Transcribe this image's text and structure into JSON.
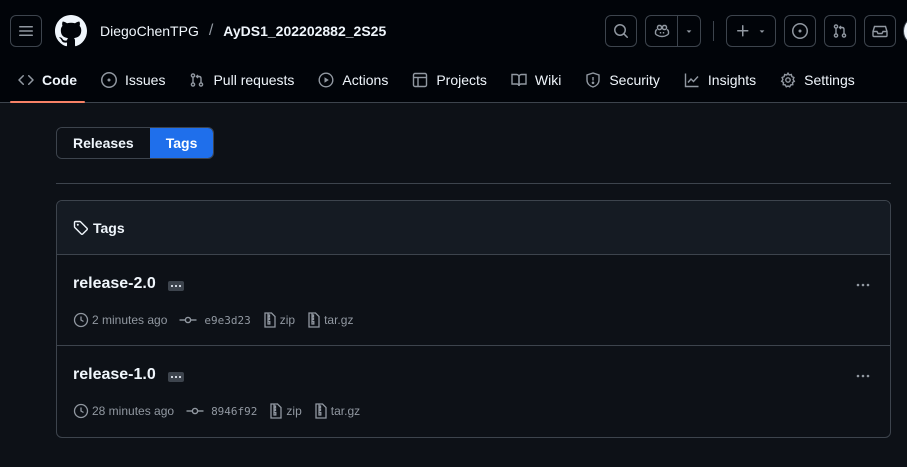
{
  "header": {
    "owner": "DiegoChenTPG",
    "separator": "/",
    "repo": "AyDS1_202202882_2S25"
  },
  "nav": {
    "tabs": [
      {
        "label": "Code",
        "icon": "code-icon",
        "selected": true
      },
      {
        "label": "Issues",
        "icon": "issue-opened-icon"
      },
      {
        "label": "Pull requests",
        "icon": "git-pull-request-icon"
      },
      {
        "label": "Actions",
        "icon": "play-icon"
      },
      {
        "label": "Projects",
        "icon": "table-icon"
      },
      {
        "label": "Wiki",
        "icon": "book-icon"
      },
      {
        "label": "Security",
        "icon": "shield-icon"
      },
      {
        "label": "Insights",
        "icon": "graph-icon"
      },
      {
        "label": "Settings",
        "icon": "gear-icon"
      }
    ]
  },
  "segmented": {
    "releases_label": "Releases",
    "tags_label": "Tags",
    "active": "Tags"
  },
  "tags_box": {
    "title": "Tags",
    "rows": [
      {
        "name": "release-2.0",
        "time": "2 minutes ago",
        "commit": "e9e3d23",
        "zip": "zip",
        "targz": "tar.gz"
      },
      {
        "name": "release-1.0",
        "time": "28 minutes ago",
        "commit": "8946f92",
        "zip": "zip",
        "targz": "tar.gz"
      }
    ]
  },
  "colors": {
    "background": "#0d1117",
    "header_bg": "#010409",
    "accent": "#1f6feb",
    "selected_underline": "#f78166",
    "border": "#3d444d",
    "muted_text": "#9198a1"
  }
}
